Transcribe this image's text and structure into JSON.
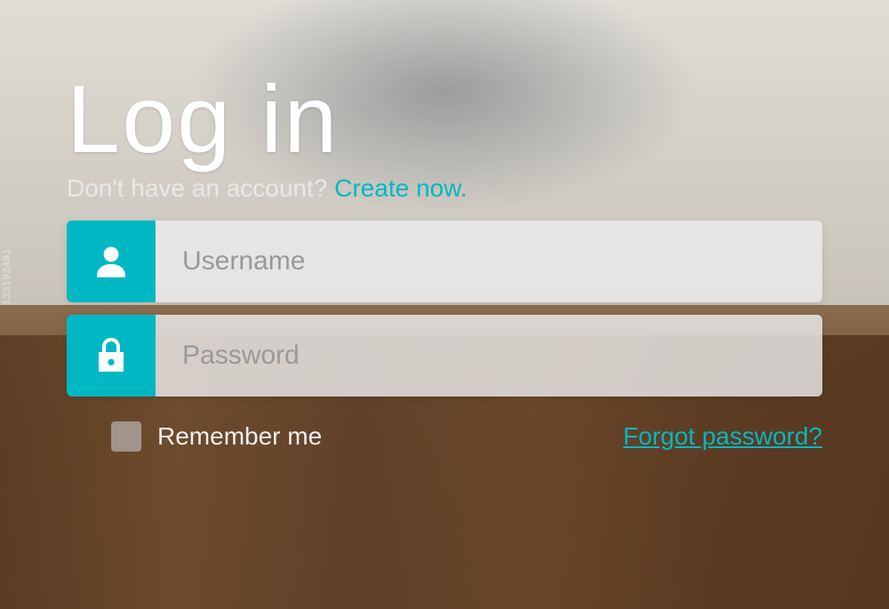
{
  "login": {
    "title": "Log in",
    "subtitle": "Don't have an account?",
    "create_link": "Create now.",
    "username_placeholder": "Username",
    "password_placeholder": "Password",
    "remember_label": "Remember me",
    "forgot_link": "Forgot password?"
  },
  "icons": {
    "user": "user-icon",
    "lock": "lock-icon"
  },
  "colors": {
    "accent": "#00b8c4",
    "input_bg": "rgba(235,235,235,0.82)"
  },
  "watermark": "133192491"
}
